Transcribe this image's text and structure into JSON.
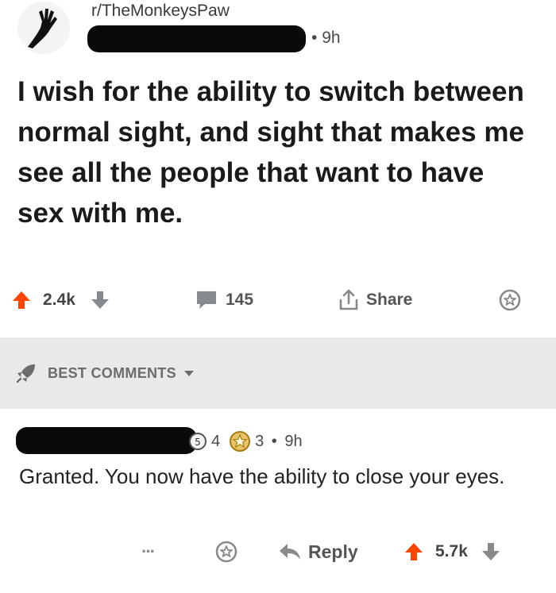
{
  "post": {
    "subreddit": "r/TheMonkeysPaw",
    "time": "9h",
    "title": "I wish for the ability to switch between normal sight, and sight that makes me see all the people that want to have sex with me.",
    "upvotes": "2.4k",
    "comments": "145",
    "share_label": "Share"
  },
  "sort": {
    "label": "BEST COMMENTS"
  },
  "comment": {
    "award_count_1": "4",
    "award_count_2": "3",
    "time": "9h",
    "body": "Granted. You now have the ability to close your eyes.",
    "more": "···",
    "reply_label": "Reply",
    "score": "5.7k"
  },
  "colors": {
    "upvote": "#ff4500",
    "divider": "#e9e9ec",
    "icon_gray": "#878a8c"
  },
  "icons": [
    "monkey-paw-avatar-icon",
    "upvote-arrow-icon",
    "downvote-arrow-icon",
    "comment-bubble-icon",
    "share-icon",
    "award-icon",
    "rocket-icon",
    "chevron-down-icon",
    "reply-arrow-icon"
  ]
}
